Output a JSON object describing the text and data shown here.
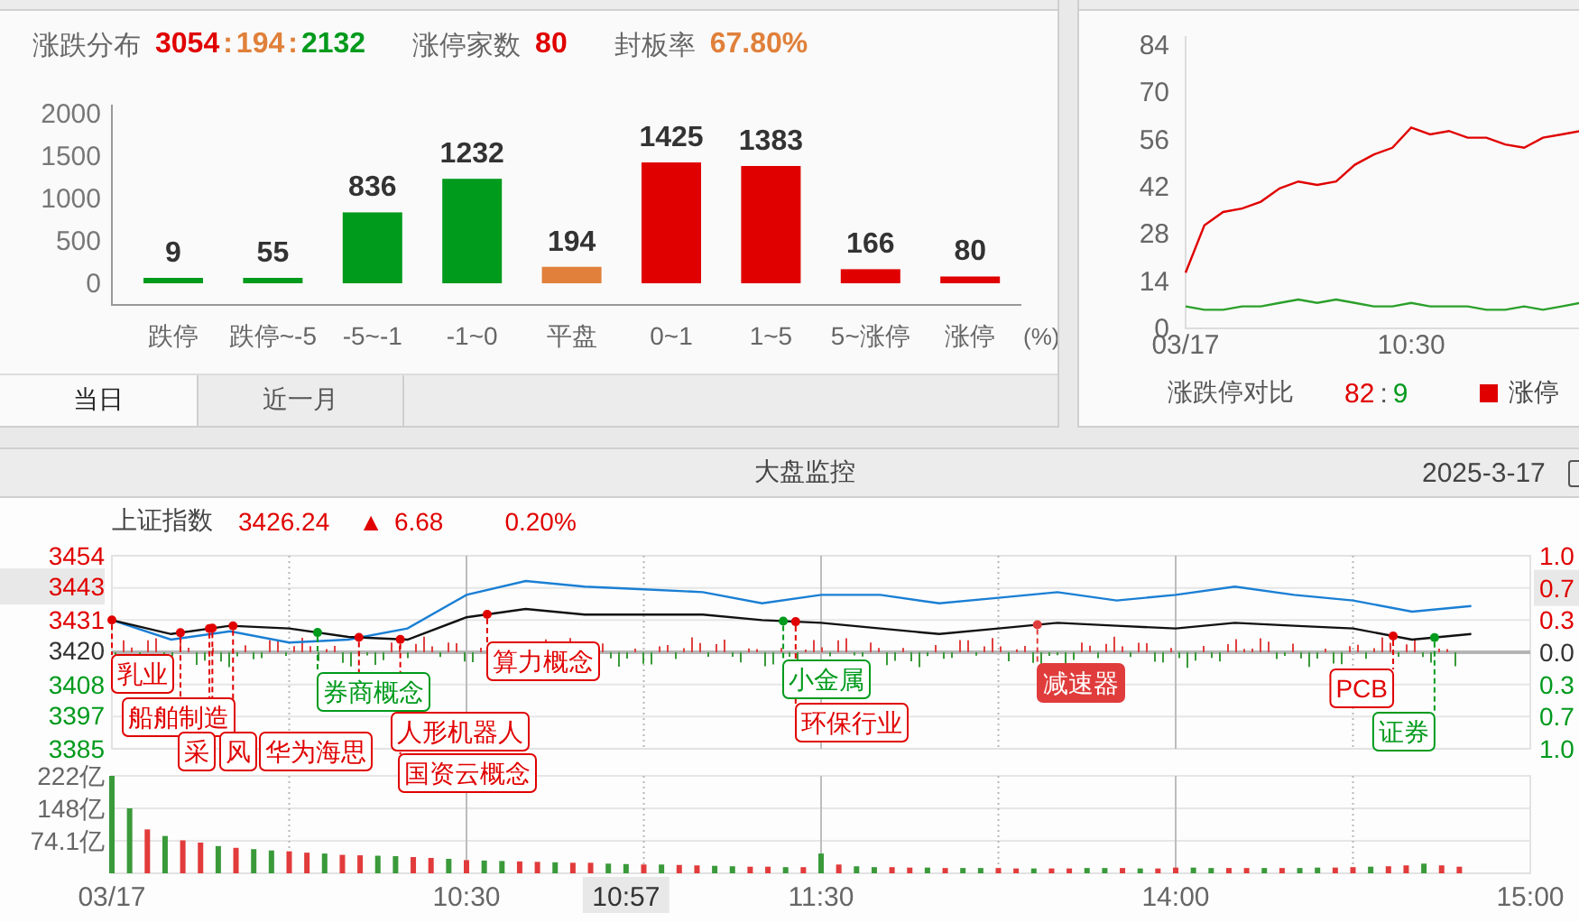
{
  "top_left_panel": {
    "summary": [
      {
        "label": "涨跌分布",
        "values": [
          {
            "text": "3054",
            "color": "#e00000"
          },
          {
            "text": ":",
            "color": "#e0803a"
          },
          {
            "text": "194",
            "color": "#e0803a"
          },
          {
            "text": ":",
            "color": "#e0803a"
          },
          {
            "text": "2132",
            "color": "#009a1c"
          }
        ]
      },
      {
        "label": "涨停家数",
        "values": [
          {
            "text": "80",
            "color": "#e00000"
          }
        ]
      },
      {
        "label": "封板率",
        "values": [
          {
            "text": "67.80%",
            "color": "#e0803a"
          }
        ]
      }
    ],
    "unit_label": "(%)",
    "chart_data": {
      "type": "bar",
      "categories": [
        "跌停",
        "跌停~-5",
        "-5~-1",
        "-1~0",
        "平盘",
        "0~1",
        "1~5",
        "5~涨停",
        "涨停"
      ],
      "series": [
        {
          "color": "#009a1c",
          "values": [
            9,
            55,
            836,
            1232,
            null,
            null,
            null,
            null,
            null
          ]
        },
        {
          "color": "#e0803a",
          "values": [
            null,
            null,
            null,
            null,
            194,
            null,
            null,
            null,
            null
          ]
        },
        {
          "color": "#e00000",
          "values": [
            null,
            null,
            null,
            null,
            null,
            1425,
            1383,
            166,
            80
          ]
        }
      ],
      "ylim": [
        0,
        2000
      ],
      "yticks": [
        0,
        500,
        1000,
        1500,
        2000
      ],
      "data_labels": true
    },
    "tabs": [
      {
        "label": "当日",
        "selected": true
      },
      {
        "label": "近一月",
        "selected": false
      }
    ]
  },
  "limit_panel": {
    "chart_data": {
      "type": "line",
      "categories": [
        "03/17",
        null,
        null,
        null,
        null,
        null,
        null,
        null,
        null,
        null,
        null,
        null,
        "10:30",
        null,
        null,
        null,
        null,
        null,
        null,
        null,
        null,
        null
      ],
      "ylim": [
        0,
        84
      ],
      "yticks": [
        0,
        14,
        28,
        42,
        56,
        70,
        84
      ],
      "series": [
        {
          "name": "涨停",
          "color": "#e00000",
          "values": [
            16,
            30,
            34,
            35,
            37,
            41,
            43,
            42,
            43,
            48,
            51,
            53,
            59,
            57,
            58,
            56,
            56,
            54,
            53,
            56,
            57,
            58
          ]
        },
        {
          "color": "#2aa02a",
          "values": [
            6,
            5,
            5,
            6,
            6,
            7,
            8,
            7,
            8,
            7,
            6,
            6,
            7,
            6,
            6,
            6,
            5,
            5,
            6,
            5,
            6,
            7
          ]
        }
      ]
    },
    "legend": {
      "label": "涨跌停对比",
      "up": "82",
      "separator": ":",
      "down": "9"
    }
  },
  "monitor": {
    "title": "大盘监控",
    "date": "2025-3-17",
    "index": {
      "name": "上证指数",
      "price": "3426.24",
      "arrow": "▲",
      "change": "6.68",
      "percent": "0.20%"
    },
    "percent_axis": [
      {
        "text": "1.0",
        "color": "#e00000",
        "selected": false
      },
      {
        "text": "0.7",
        "color": "#e00000",
        "selected": true
      },
      {
        "text": "0.3",
        "color": "#e00000",
        "selected": false
      },
      {
        "text": "0.0",
        "color": "#333333",
        "selected": false
      },
      {
        "text": "0.3",
        "color": "#009a1c",
        "selected": false
      },
      {
        "text": "0.7",
        "color": "#009a1c",
        "selected": false
      },
      {
        "text": "1.0",
        "color": "#009a1c",
        "selected": false
      }
    ],
    "chart_data": {
      "type": "line",
      "ylim": [
        3385,
        3454
      ],
      "yticks": [
        {
          "value": 3385,
          "label": "3385"
        },
        {
          "value": 3397,
          "label": "3397"
        },
        {
          "value": 3408,
          "label": "3408"
        },
        {
          "value": 3420,
          "label": "3420"
        },
        {
          "value": 3431,
          "label": "3431"
        },
        {
          "value": 3443,
          "label": "3443"
        },
        {
          "value": 3454,
          "label": "3454"
        }
      ],
      "series": [
        {
          "color": "#1a7fd4",
          "values": [
            3431,
            3424,
            3427,
            3423,
            3424,
            3428,
            3440,
            3445,
            3443,
            3442,
            3441,
            3437,
            3440,
            3440,
            3437,
            3439,
            3441,
            3438,
            3440,
            3443,
            3440,
            3438,
            3434,
            3436
          ]
        },
        {
          "color": "#111111",
          "values": [
            3431,
            3426,
            3429,
            3428,
            3425,
            3424,
            3432,
            3435,
            3433,
            3433,
            3433,
            3431,
            3430,
            3428,
            3426,
            3428,
            3430,
            3429,
            3428,
            3430,
            3429,
            3428,
            3424,
            3426
          ]
        }
      ]
    },
    "tags": [
      {
        "label": "乳业",
        "color": "#e00000",
        "filled": false
      },
      {
        "label": "船舶制造",
        "color": "#e00000",
        "filled": false
      },
      {
        "label": "采",
        "color": "#e00000",
        "filled": false
      },
      {
        "label": "风",
        "color": "#e00000",
        "filled": false
      },
      {
        "label": "华为海思",
        "color": "#e00000",
        "filled": false
      },
      {
        "label": "券商概念",
        "color": "#009a1c",
        "filled": false
      },
      {
        "label": "人形机器人",
        "color": "#e00000",
        "filled": false
      },
      {
        "label": "国资云概念",
        "color": "#e00000",
        "filled": false
      },
      {
        "label": "算力概念",
        "color": "#e00000",
        "filled": false
      },
      {
        "label": "小金属",
        "color": "#009a1c",
        "filled": false
      },
      {
        "label": "环保行业",
        "color": "#e00000",
        "filled": false
      },
      {
        "label": "减速器",
        "color": "#e03c3c",
        "filled": true
      },
      {
        "label": "PCB",
        "color": "#e00000",
        "filled": false
      },
      {
        "label": "证券",
        "color": "#009a1c",
        "filled": false
      }
    ],
    "volume": {
      "label_selected": [
        false,
        false,
        true,
        false,
        false,
        false
      ],
      "chart_data": {
        "type": "bar",
        "categories": [
          "03/17",
          null,
          null,
          null,
          null,
          null,
          null,
          null,
          null,
          null,
          null,
          null,
          null,
          null,
          null,
          null,
          null,
          null,
          null,
          null,
          "10:30",
          null,
          null,
          null,
          null,
          null,
          null,
          null,
          null,
          "10:57",
          null,
          null,
          null,
          null,
          null,
          null,
          null,
          null,
          null,
          null,
          "11:30",
          null,
          null,
          null,
          null,
          null,
          null,
          null,
          null,
          null,
          null,
          null,
          null,
          null,
          null,
          null,
          null,
          null,
          null,
          null,
          "14:00",
          null,
          null,
          null,
          null,
          null,
          null,
          null,
          null,
          null,
          null,
          null,
          null,
          null,
          null,
          null,
          null,
          null,
          null,
          null,
          "15:00"
        ],
        "ylim": [
          0,
          222
        ],
        "yticks": [
          {
            "value": 74.1,
            "label": "74.1亿"
          },
          {
            "value": 148,
            "label": "148亿"
          },
          {
            "value": 222,
            "label": "222亿"
          }
        ],
        "series": [
          {
            "color": "#3a9a3a",
            "values": [
              222,
              148,
              null,
              85,
              null,
              null,
              62,
              null,
              55,
              52,
              null,
              null,
              45,
              null,
              null,
              40,
              39,
              null,
              null,
              33,
              null,
              29,
              28,
              null,
              null,
              25,
              null,
              null,
              22,
              21,
              null,
              20,
              null,
              null,
              17,
              16,
              null,
              null,
              14,
              null,
              45,
              null,
              16,
              14,
              null,
              null,
              13,
              null,
              12,
              12,
              null,
              null,
              11,
              null,
              null,
              12,
              12,
              null,
              11,
              null,
              null,
              13,
              12,
              null,
              null,
              12,
              null,
              12,
              13,
              null,
              null,
              15,
              null,
              null,
              22,
              null,
              null,
              null,
              null,
              null,
              null
            ]
          },
          {
            "color": "#e23b3b",
            "values": [
              null,
              null,
              100,
              null,
              75,
              70,
              null,
              58,
              null,
              null,
              50,
              47,
              null,
              42,
              41,
              null,
              null,
              37,
              35,
              null,
              30,
              null,
              null,
              27,
              26,
              null,
              24,
              24,
              null,
              null,
              20,
              null,
              19,
              18,
              null,
              null,
              15,
              15,
              null,
              14,
              null,
              20,
              null,
              null,
              14,
              13,
              null,
              12,
              null,
              null,
              12,
              11,
              null,
              11,
              11,
              null,
              null,
              12,
              null,
              11,
              13,
              null,
              null,
              12,
              12,
              null,
              12,
              null,
              null,
              13,
              14,
              null,
              16,
              18,
              null,
              18,
              15,
              null,
              null,
              null,
              null
            ]
          }
        ]
      }
    }
  }
}
